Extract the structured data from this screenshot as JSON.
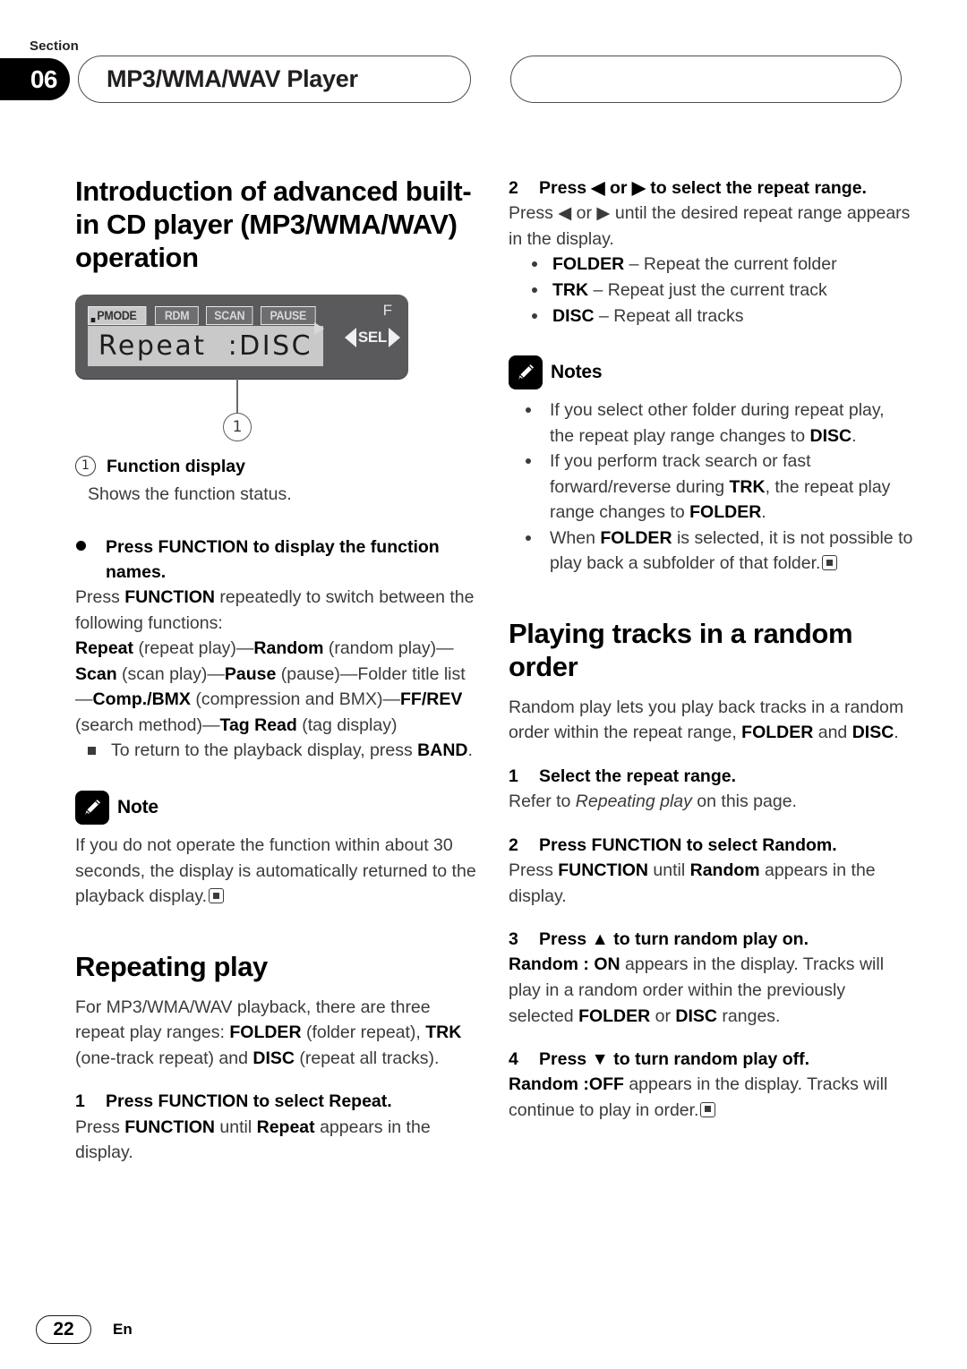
{
  "header": {
    "section_label": "Section",
    "section_number": "06",
    "title": "MP3/WMA/WAV Player",
    "right_pill_title": ""
  },
  "left_column": {
    "heading": "Introduction of advanced built-in CD player (MP3/WMA/WAV) operation",
    "figure": {
      "tags": [
        {
          "name": "PMODE",
          "active": true
        },
        {
          "name": "RDM",
          "active": false
        },
        {
          "name": "SCAN",
          "active": false
        },
        {
          "name": "PAUSE",
          "active": false
        }
      ],
      "lcd_text": "Repeat  :DISC",
      "f_indicator": "F",
      "sel_label": "SEL",
      "callout_number": "1"
    },
    "callout_ref_number": "1",
    "callout_label": "Function display",
    "callout_desc": "Shows the function status.",
    "bullet_head": "Press FUNCTION to display the function names.",
    "para_1_a": "Press ",
    "para_1_b": "FUNCTION",
    "para_1_c": " repeatedly to switch between the following functions:",
    "functions_chain": [
      {
        "text": "Repeat",
        "bold": true
      },
      {
        "text": " (repeat play)—",
        "bold": false
      },
      {
        "text": "Random",
        "bold": true
      },
      {
        "text": " (random play)—",
        "bold": false
      },
      {
        "text": "Scan",
        "bold": true
      },
      {
        "text": " (scan play)—",
        "bold": false
      },
      {
        "text": "Pause",
        "bold": true
      },
      {
        "text": " (pause)—Folder title list—",
        "bold": false
      },
      {
        "text": "Comp./BMX",
        "bold": true
      },
      {
        "text": " (compression and BMX)—",
        "bold": false
      },
      {
        "text": "FF/REV",
        "bold": true
      },
      {
        "text": " (search method)—",
        "bold": false
      },
      {
        "text": "Tag Read",
        "bold": true
      },
      {
        "text": " (tag display)",
        "bold": false
      }
    ],
    "square_note_a": "To return to the playback display, press ",
    "square_note_b": "BAND",
    "square_note_c": ".",
    "note_label": "Note",
    "note_text": "If you do not operate the function within about 30 seconds, the display is automatically returned to the playback display.",
    "repeating_heading": "Repeating play",
    "repeating_para": [
      {
        "text": "For MP3/WMA/WAV playback, there are three repeat play ranges: ",
        "bold": false
      },
      {
        "text": "FOLDER",
        "bold": true
      },
      {
        "text": " (folder repeat), ",
        "bold": false
      },
      {
        "text": "TRK",
        "bold": true
      },
      {
        "text": " (one-track repeat) and ",
        "bold": false
      },
      {
        "text": "DISC",
        "bold": true
      },
      {
        "text": " (repeat all tracks).",
        "bold": false
      }
    ],
    "step1_num": "1",
    "step1_head": "Press FUNCTION to select Repeat.",
    "step1_body": [
      {
        "text": "Press ",
        "bold": false
      },
      {
        "text": "FUNCTION",
        "bold": true
      },
      {
        "text": " until ",
        "bold": false
      },
      {
        "text": "Repeat",
        "bold": true
      },
      {
        "text": " appears in the display.",
        "bold": false
      }
    ]
  },
  "right_column": {
    "step2_num": "2",
    "step2_head": "Press ◀ or ▶ to select the repeat range.",
    "step2_body": "Press ◀ or ▶ until the desired repeat range appears in the display.",
    "range_options": [
      {
        "name": "FOLDER",
        "desc": " – Repeat the current folder"
      },
      {
        "name": "TRK",
        "desc": " – Repeat just the current track"
      },
      {
        "name": "DISC",
        "desc": " – Repeat all tracks"
      }
    ],
    "notes_label": "Notes",
    "notes": [
      [
        {
          "text": "If you select other folder during repeat play, the repeat play range changes to ",
          "bold": false
        },
        {
          "text": "DISC",
          "bold": true
        },
        {
          "text": ".",
          "bold": false
        }
      ],
      [
        {
          "text": "If you perform track search or fast forward/reverse during ",
          "bold": false
        },
        {
          "text": "TRK",
          "bold": true
        },
        {
          "text": ", the repeat play range changes to ",
          "bold": false
        },
        {
          "text": "FOLDER",
          "bold": true
        },
        {
          "text": ".",
          "bold": false
        }
      ],
      [
        {
          "text": "When ",
          "bold": false
        },
        {
          "text": "FOLDER",
          "bold": true
        },
        {
          "text": " is selected, it is not possible to play back a subfolder of that folder.",
          "bold": false
        }
      ]
    ],
    "random_heading": "Playing tracks in a random order",
    "random_para": [
      {
        "text": "Random play lets you play back tracks in a random order within the repeat range, ",
        "bold": false
      },
      {
        "text": "FOLDER",
        "bold": true
      },
      {
        "text": " and ",
        "bold": false
      },
      {
        "text": "DISC",
        "bold": true
      },
      {
        "text": ".",
        "bold": false
      }
    ],
    "step1_num": "1",
    "step1_head": "Select the repeat range.",
    "step1_body_a": "Refer to ",
    "step1_body_i": "Repeating play",
    "step1_body_b": " on this page.",
    "step2b_num": "2",
    "step2b_head": "Press FUNCTION to select Random.",
    "step2b_body": [
      {
        "text": "Press ",
        "bold": false
      },
      {
        "text": "FUNCTION",
        "bold": true
      },
      {
        "text": " until ",
        "bold": false
      },
      {
        "text": "Random",
        "bold": true
      },
      {
        "text": " appears in the display.",
        "bold": false
      }
    ],
    "step3_num": "3",
    "step3_head": "Press ▲ to turn random play on.",
    "step3_body": [
      {
        "text": "Random : ON",
        "bold": true
      },
      {
        "text": " appears in the display. Tracks will play in a random order within the previously selected ",
        "bold": false
      },
      {
        "text": "FOLDER",
        "bold": true
      },
      {
        "text": " or ",
        "bold": false
      },
      {
        "text": "DISC",
        "bold": true
      },
      {
        "text": " ranges.",
        "bold": false
      }
    ],
    "step4_num": "4",
    "step4_head": "Press ▼ to turn random play off.",
    "step4_body": [
      {
        "text": "Random :OFF",
        "bold": true
      },
      {
        "text": " appears in the display. Tracks will continue to play in order.",
        "bold": false
      }
    ]
  },
  "footer": {
    "page_number": "22",
    "language": "En"
  }
}
